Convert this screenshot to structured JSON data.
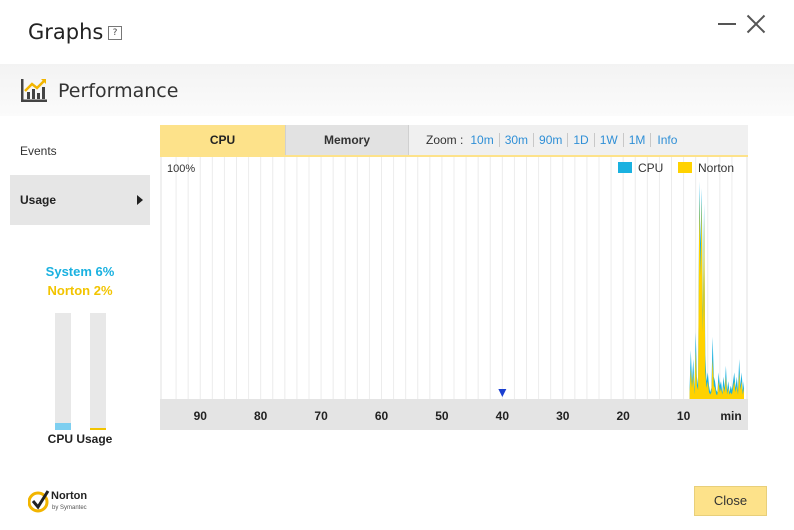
{
  "window": {
    "title": "Graphs",
    "help_symbol": "?"
  },
  "section": {
    "title": "Performance"
  },
  "sidebar": {
    "items": [
      {
        "label": "Events",
        "selected": false
      },
      {
        "label": "Usage",
        "selected": true
      }
    ]
  },
  "usage_meter": {
    "system_label": "System 6%",
    "norton_label": "Norton 2%",
    "system_value": 6,
    "norton_value": 2,
    "caption": "CPU Usage",
    "system_color": "#1ab1e0",
    "norton_color": "#f2c400"
  },
  "tabs": [
    {
      "label": "CPU",
      "active": true
    },
    {
      "label": "Memory",
      "active": false
    }
  ],
  "zoom": {
    "label": "Zoom :",
    "options": [
      "10m",
      "30m",
      "90m",
      "1D",
      "1W",
      "1M"
    ],
    "info_label": "Info"
  },
  "chart_data": {
    "type": "area",
    "y_max_label": "100%",
    "ylim": [
      0,
      100
    ],
    "x_tick_labels": [
      "90",
      "80",
      "70",
      "60",
      "50",
      "40",
      "30",
      "20",
      "10"
    ],
    "x_unit_label": "min",
    "xlim": [
      96,
      0
    ],
    "marker_at": 40,
    "legend_placement": "top-right",
    "x": [
      9,
      8.8,
      8.6,
      8.4,
      8.2,
      8,
      7.8,
      7.6,
      7.4,
      7.2,
      7,
      6.8,
      6.6,
      6.4,
      6.2,
      6,
      5.8,
      5.6,
      5.4,
      5.2,
      5,
      4.8,
      4.6,
      4.4,
      4.2,
      4,
      3.8,
      3.6,
      3.4,
      3.2,
      3,
      2.8,
      2.6,
      2.4,
      2.2,
      2,
      1.8,
      1.6,
      1.4,
      1.2,
      1,
      0.8,
      0.6,
      0.4,
      0.2,
      0
    ],
    "series": [
      {
        "name": "CPU",
        "color": "#1ab1e0",
        "values": [
          5,
          22,
          8,
          18,
          4,
          30,
          10,
          6,
          98,
          70,
          95,
          40,
          88,
          20,
          8,
          12,
          6,
          3,
          5,
          28,
          10,
          8,
          4,
          3,
          12,
          6,
          8,
          3,
          10,
          5,
          15,
          4,
          8,
          3,
          6,
          4,
          8,
          12,
          5,
          10,
          4,
          18,
          6,
          12,
          4,
          8
        ]
      },
      {
        "name": "Norton",
        "color": "#ffd200",
        "values": [
          3,
          14,
          5,
          12,
          2,
          22,
          6,
          4,
          92,
          55,
          90,
          30,
          82,
          12,
          5,
          8,
          3,
          2,
          3,
          18,
          6,
          5,
          2,
          2,
          8,
          3,
          5,
          2,
          6,
          3,
          10,
          2,
          5,
          2,
          3,
          2,
          5,
          8,
          3,
          6,
          2,
          12,
          4,
          8,
          2,
          5
        ]
      }
    ]
  },
  "footer": {
    "brand": "Norton",
    "brand_sub": "by Symantec",
    "close_label": "Close"
  }
}
